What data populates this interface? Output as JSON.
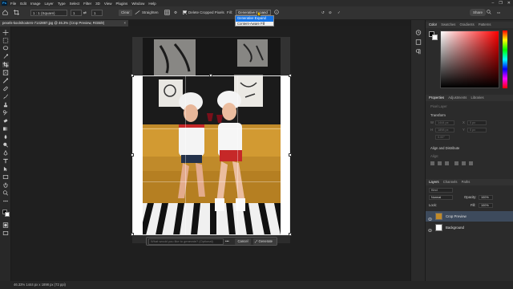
{
  "menubar": {
    "logo": "Ps",
    "items": [
      "File",
      "Edit",
      "Image",
      "Layer",
      "Type",
      "Select",
      "Filter",
      "3D",
      "View",
      "Plugins",
      "Window",
      "Help"
    ],
    "window_controls": [
      "–",
      "❐",
      "✕"
    ]
  },
  "options": {
    "ratio": "1 : 1 (Square)",
    "ratio_w": "1",
    "ratio_h": "1",
    "clear": "Clear",
    "straighten": "Straighten",
    "delete_cropped": "Delete Cropped Pixels",
    "fill_label": "Fill:",
    "fill_value": "Generative Expand",
    "fill_options": [
      "Generative Expand",
      "Content-Aware Fill"
    ],
    "share": "Share"
  },
  "document": {
    "tab_title": "pexels-koolshooters-7142887.jpg @ 46.3% (Crop Preview, RGB/8)",
    "tab_close": "×"
  },
  "genfill": {
    "prompt_placeholder": "What would you like to generate? (Optional)",
    "more": "•••",
    "cancel": "Cancel",
    "generate": "Generate"
  },
  "status": {
    "text": "46.33%    1444 px x 1898 px (72 ppi)"
  },
  "panels": {
    "color_tabs": [
      "Color",
      "Swatches",
      "Gradients",
      "Patterns"
    ],
    "properties_tabs": [
      "Properties",
      "Adjustments",
      "Libraries"
    ],
    "pixel_layer": "Pixel Layer",
    "transform": "Transform",
    "align": "Align and Distribute",
    "align_label": "Align:",
    "w_label": "W",
    "h_label": "H",
    "x_label": "X",
    "y_label": "Y",
    "w_val": "1444 px",
    "h_val": "1898 px",
    "x_val": "0 px",
    "y_val": "0 px",
    "angle": "0.00°",
    "layers_tabs": [
      "Layers",
      "Channels",
      "Paths"
    ],
    "kind_label": "Kind",
    "blend_mode": "Normal",
    "opacity_label": "Opacity:",
    "opacity": "100%",
    "lock_label": "Lock:",
    "fill_label": "Fill:",
    "fill": "100%",
    "layers": [
      {
        "name": "Crop Preview",
        "selected": true
      },
      {
        "name": "Background",
        "selected": false
      }
    ]
  },
  "colors": {
    "accent": "#1473e6",
    "canvas_bg": "#1f1f1f",
    "panel_bg": "#2b2b2b"
  }
}
